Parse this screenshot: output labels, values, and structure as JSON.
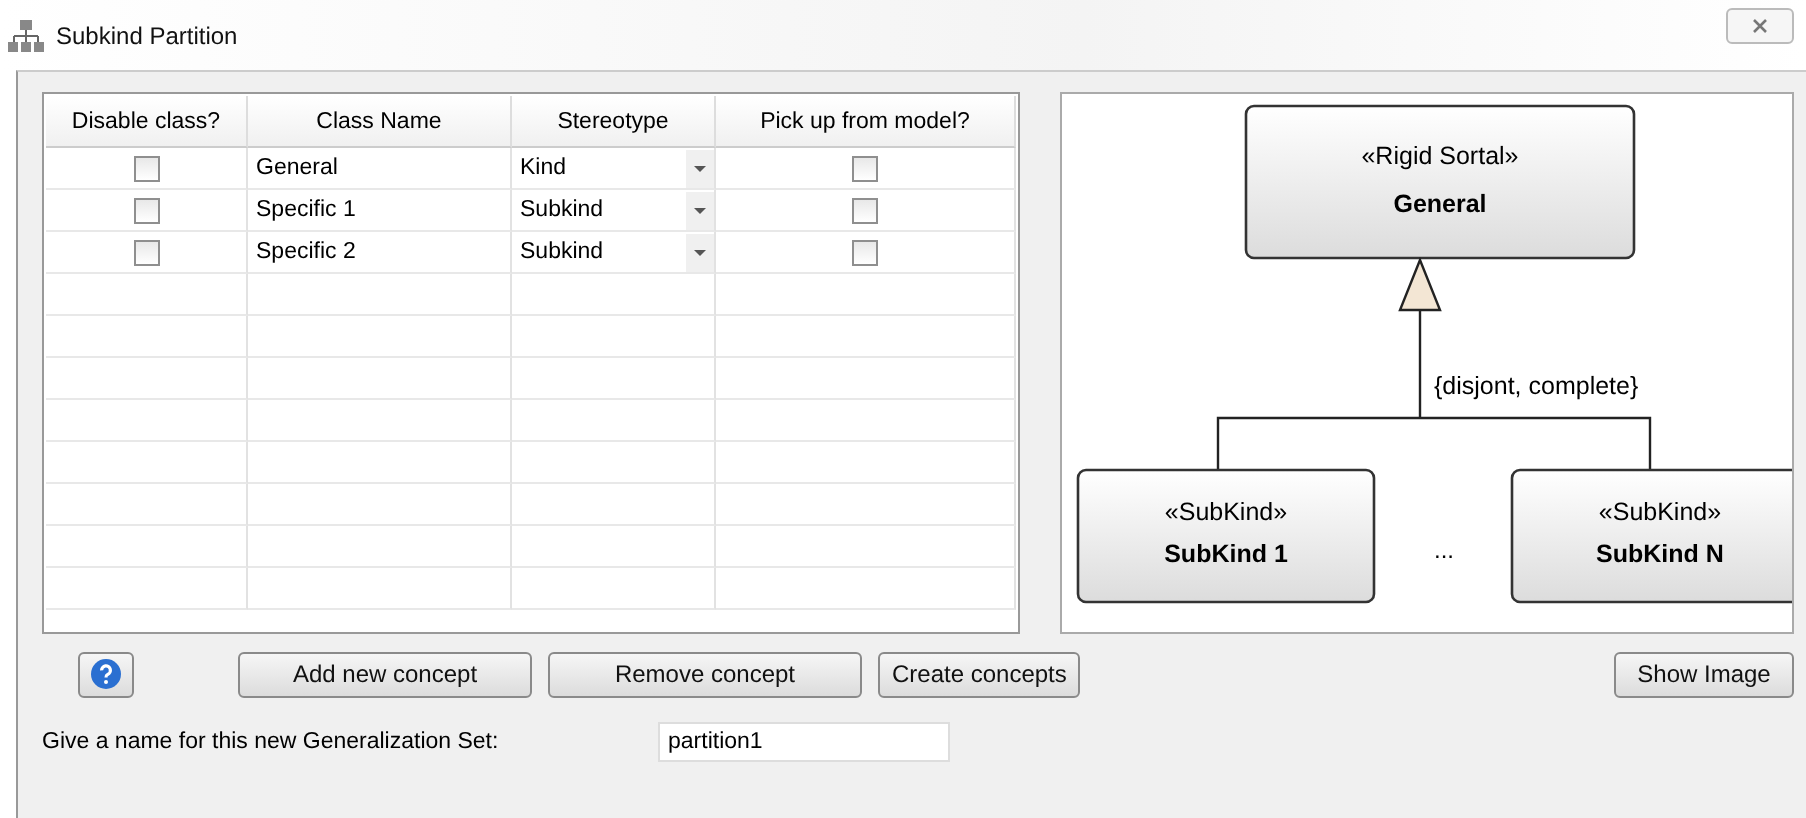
{
  "window": {
    "title": "Subkind Partition"
  },
  "table": {
    "columns": [
      "Disable class?",
      "Class Name",
      "Stereotype",
      "Pick up from model?"
    ],
    "rows": [
      {
        "disable_class": false,
        "class_name": "General",
        "stereotype": "Kind",
        "pick_up_from_model": false
      },
      {
        "disable_class": false,
        "class_name": "Specific 1",
        "stereotype": "Subkind",
        "pick_up_from_model": false
      },
      {
        "disable_class": false,
        "class_name": "Specific 2",
        "stereotype": "Subkind",
        "pick_up_from_model": false
      }
    ]
  },
  "diagram": {
    "general": {
      "stereotype": "«Rigid Sortal»",
      "name": "General"
    },
    "constraint": "{disjont, complete}",
    "subkinds": [
      {
        "stereotype": "«SubKind»",
        "name": "SubKind 1"
      },
      {
        "stereotype": "«SubKind»",
        "name": "SubKind N"
      }
    ],
    "ellipsis": "..."
  },
  "buttons": {
    "left": [
      "Add new concept",
      "Remove concept",
      "Create concepts"
    ],
    "right": "Show Image"
  },
  "name_field": {
    "label": "Give a name for this new Generalization Set:",
    "value": "partition1"
  }
}
